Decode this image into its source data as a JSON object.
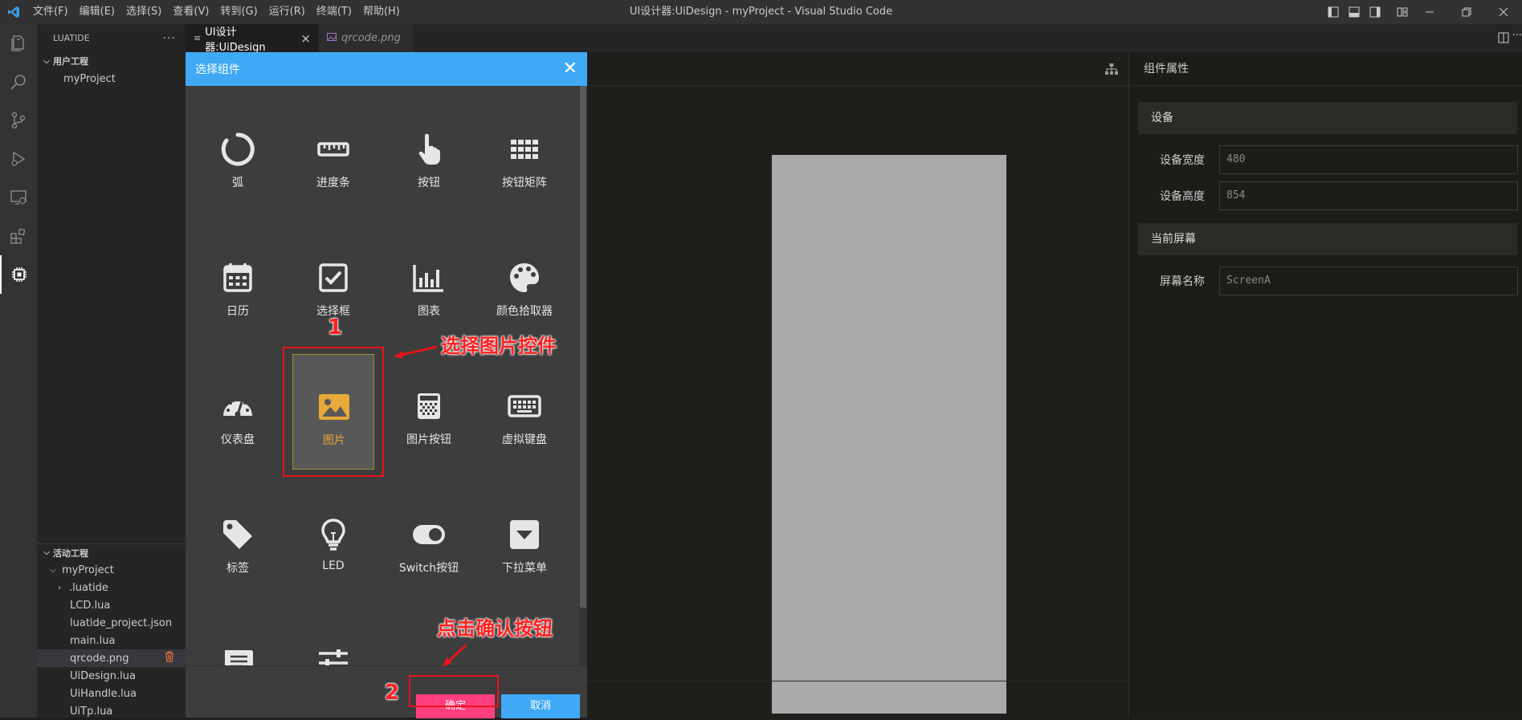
{
  "window": {
    "title": "UI设计器:UiDesign - myProject - Visual Studio Code"
  },
  "menu": [
    "文件(F)",
    "编辑(E)",
    "选择(S)",
    "查看(V)",
    "转到(G)",
    "运行(R)",
    "终端(T)",
    "帮助(H)"
  ],
  "sidebar": {
    "title": "LUATIDE",
    "more": "···",
    "user_section": "用户工程",
    "user_project": "myProject",
    "active_section": "活动工程",
    "active_project": "myProject",
    "files": [
      ".luatide",
      "LCD.lua",
      "luatide_project.json",
      "main.lua",
      "qrcode.png",
      "UiDesign.lua",
      "UiHandle.lua",
      "UiTp.lua"
    ]
  },
  "tabs": [
    {
      "label": "UI设计器:UiDesign",
      "close": "×"
    },
    {
      "label": "qrcode.png"
    }
  ],
  "props": {
    "header": "组件属性",
    "device_group": "设备",
    "width_label": "设备宽度",
    "width_value": "480",
    "height_label": "设备高度",
    "height_value": "854",
    "screen_group": "当前屏幕",
    "screen_name_label": "屏幕名称",
    "screen_name_value": "ScreenA"
  },
  "dialog": {
    "title": "选择组件",
    "close": "✕",
    "items": [
      {
        "label": "弧",
        "icon": "arc-icon"
      },
      {
        "label": "进度条",
        "icon": "ruler-icon"
      },
      {
        "label": "按钮",
        "icon": "pointer-hand-icon"
      },
      {
        "label": "按钮矩阵",
        "icon": "grid-icon"
      },
      {
        "label": "日历",
        "icon": "calendar-icon"
      },
      {
        "label": "选择框",
        "icon": "checkbox-icon"
      },
      {
        "label": "图表",
        "icon": "chart-icon"
      },
      {
        "label": "颜色拾取器",
        "icon": "palette-icon"
      },
      {
        "label": "仪表盘",
        "icon": "gauge-icon"
      },
      {
        "label": "图片",
        "icon": "image-icon"
      },
      {
        "label": "图片按钮",
        "icon": "image-button-icon"
      },
      {
        "label": "虚拟键盘",
        "icon": "keyboard-icon"
      },
      {
        "label": "标签",
        "icon": "tag-icon"
      },
      {
        "label": "LED",
        "icon": "bulb-icon"
      },
      {
        "label": "Switch按钮",
        "icon": "toggle-icon"
      },
      {
        "label": "下拉菜单",
        "icon": "dropdown-icon"
      },
      {
        "label": "",
        "icon": "message-icon"
      },
      {
        "label": "",
        "icon": "sliders-icon"
      }
    ],
    "selected": "图片",
    "ok": "确定",
    "cancel": "取消"
  },
  "annotations": {
    "step1_num": "1",
    "step1_text": "选择图片控件",
    "step2_num": "2",
    "step2_text": "点击确认按钮"
  },
  "colors": {
    "accent": "#3fa9f5",
    "ok_button": "#ff3e7f",
    "annotation": "#e8141c",
    "selected_label": "#e8a93a"
  }
}
